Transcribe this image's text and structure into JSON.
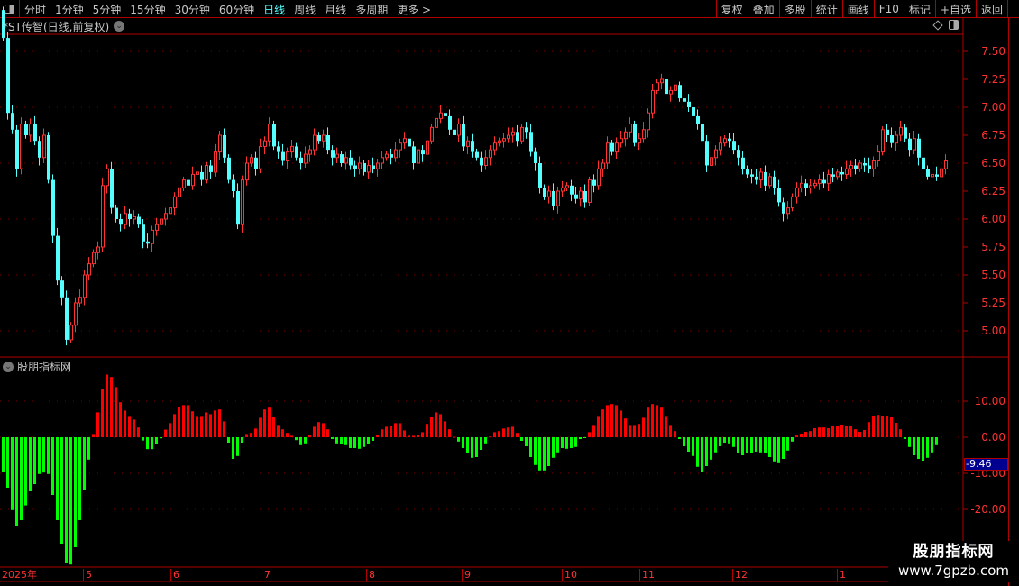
{
  "toolbar": {
    "periods": [
      "分时",
      "1分钟",
      "5分钟",
      "15分钟",
      "30分钟",
      "60分钟",
      "日线",
      "周线",
      "月线",
      "多周期",
      "更多 >"
    ],
    "active_period": "日线",
    "buttons": [
      "复权",
      "叠加",
      "多股",
      "统计",
      "画线",
      "F10",
      "标记",
      "+自选",
      "返回"
    ]
  },
  "chart_title": "*ST传智(日线,前复权)",
  "indicator_title": "股朋指标网",
  "cursor_value": "-9.46",
  "watermark": {
    "line1": "股朋指标网",
    "line2": "www.7gpzb.com"
  },
  "colors": {
    "up": "#ff3232",
    "down": "#54ffff",
    "hist_up": "#ff0000",
    "hist_down": "#00ff00",
    "axis": "#ff3232",
    "active_tab": "#54ffff",
    "border": "#b00000"
  },
  "chart_data": [
    {
      "type": "candlestick",
      "y_ticks": [
        "7.50",
        "7.25",
        "7.00",
        "6.75",
        "6.50",
        "6.25",
        "6.00",
        "5.75",
        "5.50",
        "5.25",
        "5.00"
      ],
      "ylim": [
        4.85,
        7.72
      ],
      "grid": true,
      "close": [
        7.62,
        6.95,
        6.8,
        6.45,
        6.85,
        6.75,
        6.85,
        6.7,
        6.55,
        6.75,
        6.35,
        5.85,
        5.45,
        5.3,
        4.92,
        5.05,
        5.25,
        5.3,
        5.5,
        5.6,
        5.7,
        5.75,
        6.3,
        6.45,
        6.1,
        6.0,
        5.95,
        6.05,
        6.0,
        6.02,
        5.95,
        5.8,
        5.78,
        5.9,
        5.95,
        6.0,
        6.05,
        6.1,
        6.2,
        6.28,
        6.35,
        6.3,
        6.4,
        6.42,
        6.35,
        6.48,
        6.42,
        6.6,
        6.75,
        6.55,
        6.35,
        6.25,
        5.95,
        6.35,
        6.5,
        6.55,
        6.45,
        6.65,
        6.7,
        6.85,
        6.65,
        6.6,
        6.52,
        6.6,
        6.65,
        6.55,
        6.5,
        6.58,
        6.62,
        6.75,
        6.7,
        6.75,
        6.62,
        6.55,
        6.58,
        6.5,
        6.55,
        6.48,
        6.45,
        6.5,
        6.42,
        6.48,
        6.45,
        6.5,
        6.55,
        6.58,
        6.55,
        6.62,
        6.68,
        6.72,
        6.65,
        6.5,
        6.62,
        6.58,
        6.7,
        6.82,
        6.9,
        6.95,
        6.92,
        6.8,
        6.75,
        6.85,
        6.65,
        6.7,
        6.6,
        6.55,
        6.48,
        6.55,
        6.62,
        6.68,
        6.7,
        6.72,
        6.75,
        6.78,
        6.7,
        6.82,
        6.78,
        6.6,
        6.5,
        6.28,
        6.2,
        6.25,
        6.12,
        6.25,
        6.28,
        6.3,
        6.22,
        6.18,
        6.25,
        6.15,
        6.35,
        6.3,
        6.45,
        6.5,
        6.68,
        6.6,
        6.68,
        6.72,
        6.78,
        6.85,
        6.68,
        6.72,
        6.8,
        6.95,
        7.15,
        7.22,
        7.25,
        7.12,
        7.15,
        7.2,
        7.08,
        7.05,
        7.0,
        6.92,
        6.85,
        6.7,
        6.48,
        6.55,
        6.62,
        6.68,
        6.72,
        6.7,
        6.62,
        6.55,
        6.45,
        6.4,
        6.38,
        6.35,
        6.42,
        6.3,
        6.38,
        6.28,
        6.15,
        6.05,
        6.1,
        6.2,
        6.28,
        6.32,
        6.28,
        6.3,
        6.32,
        6.35,
        6.32,
        6.4,
        6.38,
        6.42,
        6.4,
        6.45,
        6.48,
        6.45,
        6.5,
        6.48,
        6.45,
        6.52,
        6.6,
        6.8,
        6.75,
        6.68,
        6.75,
        6.82,
        6.72,
        6.62,
        6.72,
        6.55,
        6.45,
        6.38,
        6.4,
        6.38,
        6.45,
        6.52
      ]
    },
    {
      "type": "bar",
      "y_ticks": [
        "10.00",
        "0.00",
        "-10.00",
        "-20.00"
      ],
      "ylim": [
        -36,
        20
      ],
      "grid": true,
      "values": [
        -9.6,
        -14,
        -20.2,
        -24.5,
        -23,
        -18.9,
        -15,
        -13,
        -10.2,
        -9.8,
        -10.2,
        -16,
        -23,
        -29.5,
        -35,
        -35.3,
        -30.5,
        -23,
        -14.5,
        -6.2,
        0.9,
        6.9,
        13.4,
        17.4,
        16.7,
        13.9,
        9.7,
        7.4,
        5.9,
        4.9,
        2.7,
        -0.9,
        -3.3,
        -3.3,
        -2,
        -0.3,
        2.1,
        3.9,
        6.4,
        8.4,
        8.9,
        8.9,
        7.2,
        5.9,
        5.9,
        6.9,
        6.4,
        7.4,
        7.7,
        4.4,
        -1.5,
        -6,
        -5.2,
        -1.5,
        0.9,
        1.2,
        2.4,
        5.4,
        7.7,
        8.2,
        5.7,
        3.4,
        2.2,
        1.2,
        0.4,
        -0.8,
        -2.2,
        -1.7,
        0.7,
        2.9,
        4.2,
        3.9,
        2.2,
        -0.5,
        -1.7,
        -2,
        -2.2,
        -3,
        -3,
        -3.2,
        -2.7,
        -2,
        -1,
        0.7,
        2.2,
        2.9,
        3.2,
        3.9,
        3.9,
        1.9,
        0.4,
        0.4,
        0.7,
        1.4,
        3.7,
        5.7,
        6.9,
        6.4,
        4.4,
        2.2,
        0.1,
        -1.2,
        -3,
        -4.5,
        -5.7,
        -5.5,
        -3.5,
        -1.7,
        0.2,
        1.4,
        1.7,
        2.4,
        2.7,
        2.9,
        1.2,
        -1,
        -2.5,
        -5.5,
        -7.7,
        -9.2,
        -9.2,
        -8,
        -5.7,
        -4.2,
        -3,
        -3.2,
        -3,
        -2.7,
        -0.5,
        -0.2,
        1.4,
        3.4,
        5.9,
        7.7,
        8.9,
        9.2,
        8.9,
        7.4,
        5.2,
        3.4,
        3.4,
        3.7,
        5.4,
        8.2,
        9.2,
        8.9,
        8.2,
        5.9,
        3.4,
        1.7,
        -0.5,
        -2.5,
        -4,
        -5.2,
        -8.2,
        -9.5,
        -8,
        -6.2,
        -4.2,
        -2.5,
        -1.5,
        -1.7,
        -2.7,
        -4.5,
        -5,
        -4.5,
        -4.5,
        -4,
        -4.2,
        -4.5,
        -5.5,
        -6.7,
        -7.2,
        -6,
        -3.7,
        -1.2,
        0.5,
        1,
        1.5,
        1.7,
        2.5,
        2.7,
        2.7,
        2.5,
        3,
        3.2,
        3.5,
        3.2,
        3,
        2.2,
        1.5,
        2,
        4.2,
        6,
        6.2,
        6,
        6,
        5.5,
        4,
        2.2,
        -0.5,
        -2.7,
        -5,
        -6,
        -6.5,
        -5.7,
        -4.2,
        -2.2
      ]
    }
  ],
  "x_axis": [
    "2025年",
    "5",
    "6",
    "7",
    "8",
    "9",
    "10",
    "11",
    "12",
    "1"
  ]
}
